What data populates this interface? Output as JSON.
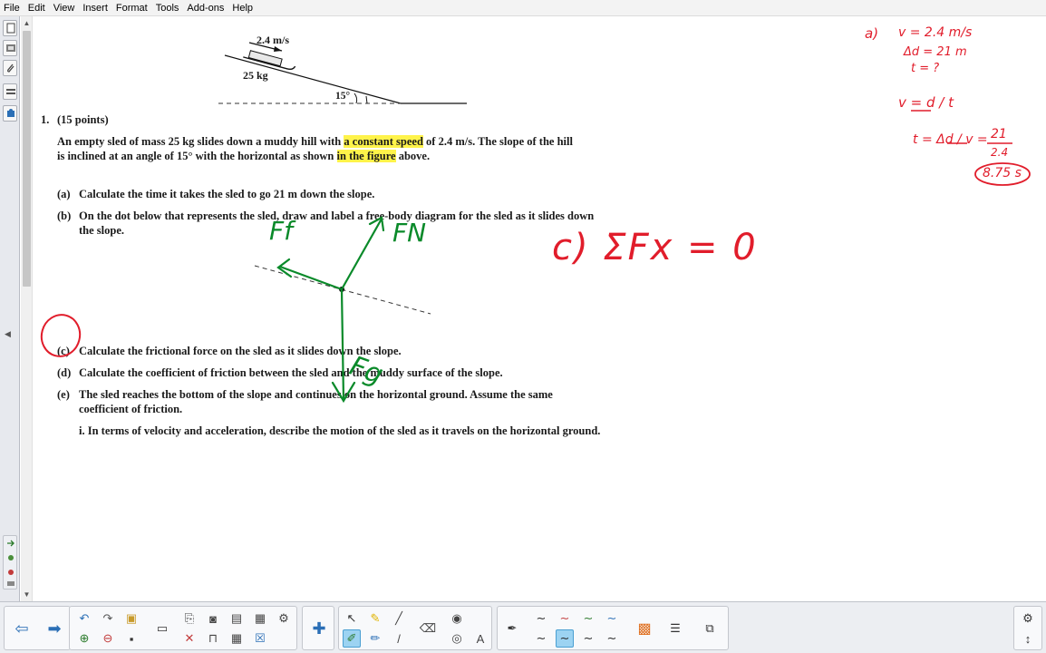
{
  "menu": {
    "items": [
      "File",
      "Edit",
      "View",
      "Insert",
      "Format",
      "Tools",
      "Add-ons",
      "Help"
    ]
  },
  "figure": {
    "speed_label": "2.4 m/s",
    "mass_label": "25 kg",
    "angle_label": "15°"
  },
  "problem": {
    "number": "1.",
    "points": "(15 points)",
    "intro_line1_a": "An empty sled of mass 25 kg slides down a muddy hill with",
    "intro_line1_highlight": "a constant speed",
    "intro_line1_b": "of 2.4 m/s. The slope of the hill",
    "intro_line2_a": "is inclined at an angle of 15°  with the horizontal as shown",
    "intro_line2_highlight": "in the figure",
    "intro_line2_b": "above.",
    "part_a_label": "(a)",
    "part_a_text": "Calculate the time it takes the sled to go 21 m down the slope.",
    "part_b_label": "(b)",
    "part_b_line1": "On the dot below that represents the sled, draw and label a free-body diagram for the sled as it slides down",
    "part_b_line2": "the slope.",
    "part_c_label": "(c)",
    "part_c_text": "Calculate the frictional force on the sled as it slides down the slope.",
    "part_d_label": "(d)",
    "part_d_text": "Calculate the coefficient of friction between the sled and the muddy surface of the slope.",
    "part_e_label": "(e)",
    "part_e_line1": "The sled reaches the bottom of the slope and continues on the horizontal ground.  Assume the same",
    "part_e_line2": "coefficient of friction.",
    "part_e_i": "i. In terms of velocity and acceleration, describe the motion of the sled as it travels on the horizontal ground."
  },
  "ink_notes": {
    "red_a_label": "a)",
    "red_v_given": "v = 2.4 m/s",
    "red_d_given": "Δd = 21 m",
    "red_t_unknown": "t = ?",
    "red_formula": "v = d / t",
    "red_calc_lhs": "t = Δd / v =",
    "red_calc_num": "21",
    "red_calc_den": "2.4",
    "red_answer": "8.75 s",
    "red_c_eq": "c) ΣFx = 0",
    "green_ff": "Ff",
    "green_fn": "FN",
    "green_fg": "Fg"
  },
  "colors": {
    "ink_red": "#e11d2b",
    "ink_green": "#0a8a2a",
    "highlight": "#fff34a"
  }
}
